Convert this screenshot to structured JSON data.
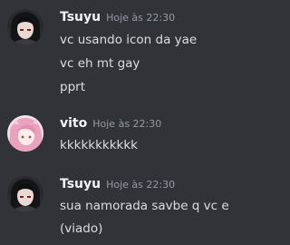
{
  "messages": [
    {
      "author": "Tsuyu",
      "timestamp": "Hoje às 22:30",
      "avatar_icon": "dark-haired-character-avatar",
      "lines": [
        "vc usando icon da yae",
        "vc eh mt gay",
        "pprt"
      ]
    },
    {
      "author": "vito",
      "timestamp": "Hoje às 22:30",
      "avatar_icon": "pink-haired-character-avatar",
      "lines": [
        "kkkkkkkkkkk"
      ]
    },
    {
      "author": "Tsuyu",
      "timestamp": "Hoje às 22:30",
      "avatar_icon": "dark-haired-character-avatar",
      "lines": [
        "sua namorada savbe q vc e",
        "(viado)"
      ]
    }
  ],
  "colors": {
    "background": "#313338",
    "username": "#f2f3f5",
    "timestamp": "#949ba4",
    "message_text": "#dbdee1"
  }
}
